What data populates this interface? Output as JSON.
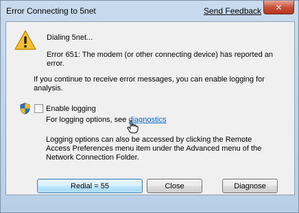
{
  "window": {
    "title": "Error Connecting to 5net",
    "feedback_link": "Send Feedback",
    "close_glyph": "✕"
  },
  "message": {
    "dialing": "Dialing 5net...",
    "error": "Error 651: The modem (or other connecting device) has reported an error.",
    "continue": "If you continue to receive error messages, you can enable logging for analysis."
  },
  "logging": {
    "checkbox_label": "Enable logging",
    "checked": false,
    "options_prefix": "For logging options, see ",
    "options_link": "diagnostics",
    "note": "Logging options can also be accessed by clicking the Remote Access Preferences menu item under the Advanced menu of the Network Connection Folder."
  },
  "buttons": {
    "redial": "Redial = 55",
    "close": "Close",
    "diagnose": "Diagnose"
  },
  "icons": {
    "warning": "warning-icon",
    "shield": "uac-shield-icon",
    "cursor": "hand-cursor-icon"
  },
  "colors": {
    "link": "#0066cc",
    "warning_fill": "#f6c12d"
  }
}
